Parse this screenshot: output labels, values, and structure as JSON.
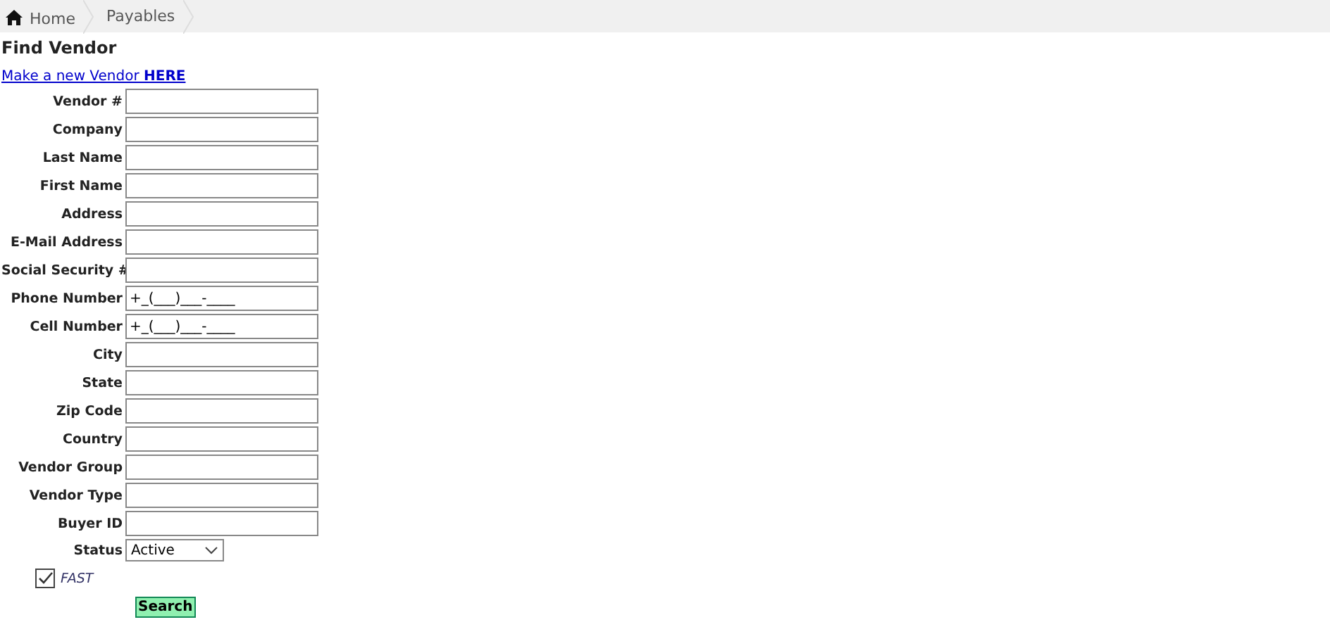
{
  "breadcrumb": [
    {
      "label": "Home",
      "kind": "home"
    },
    {
      "label": "Payables",
      "kind": "page"
    }
  ],
  "title": "Find Vendor",
  "new_link": {
    "text": "Make a new Vendor **HERE**"
  },
  "fields": [
    {
      "label": "Vendor #",
      "kind": "text"
    },
    {
      "label": "Company",
      "kind": "text"
    },
    {
      "label": "Last Name",
      "kind": "text"
    },
    {
      "label": "First Name",
      "kind": "text"
    },
    {
      "label": "Address",
      "kind": "text"
    },
    {
      "label": "E-Mail Address",
      "kind": "text"
    },
    {
      "label": "Social Security #",
      "kind": "text"
    },
    {
      "label": "Phone Number",
      "kind": "text",
      "value": "+_(___)___-____"
    },
    {
      "label": "Cell Number",
      "kind": "text",
      "value": "+_(___)___-____"
    },
    {
      "label": "City",
      "kind": "text"
    },
    {
      "label": "State",
      "kind": "text"
    },
    {
      "label": "Zip Code",
      "kind": "text"
    },
    {
      "label": "Country",
      "kind": "text"
    },
    {
      "label": "Vendor Group",
      "kind": "text"
    },
    {
      "label": "Vendor Type",
      "kind": "text"
    },
    {
      "label": "Buyer ID",
      "kind": "text"
    },
    {
      "label": "Status",
      "kind": "select",
      "value": "Active"
    }
  ],
  "fast": {
    "label": "FAST",
    "checked": true
  },
  "search_button": "Search"
}
